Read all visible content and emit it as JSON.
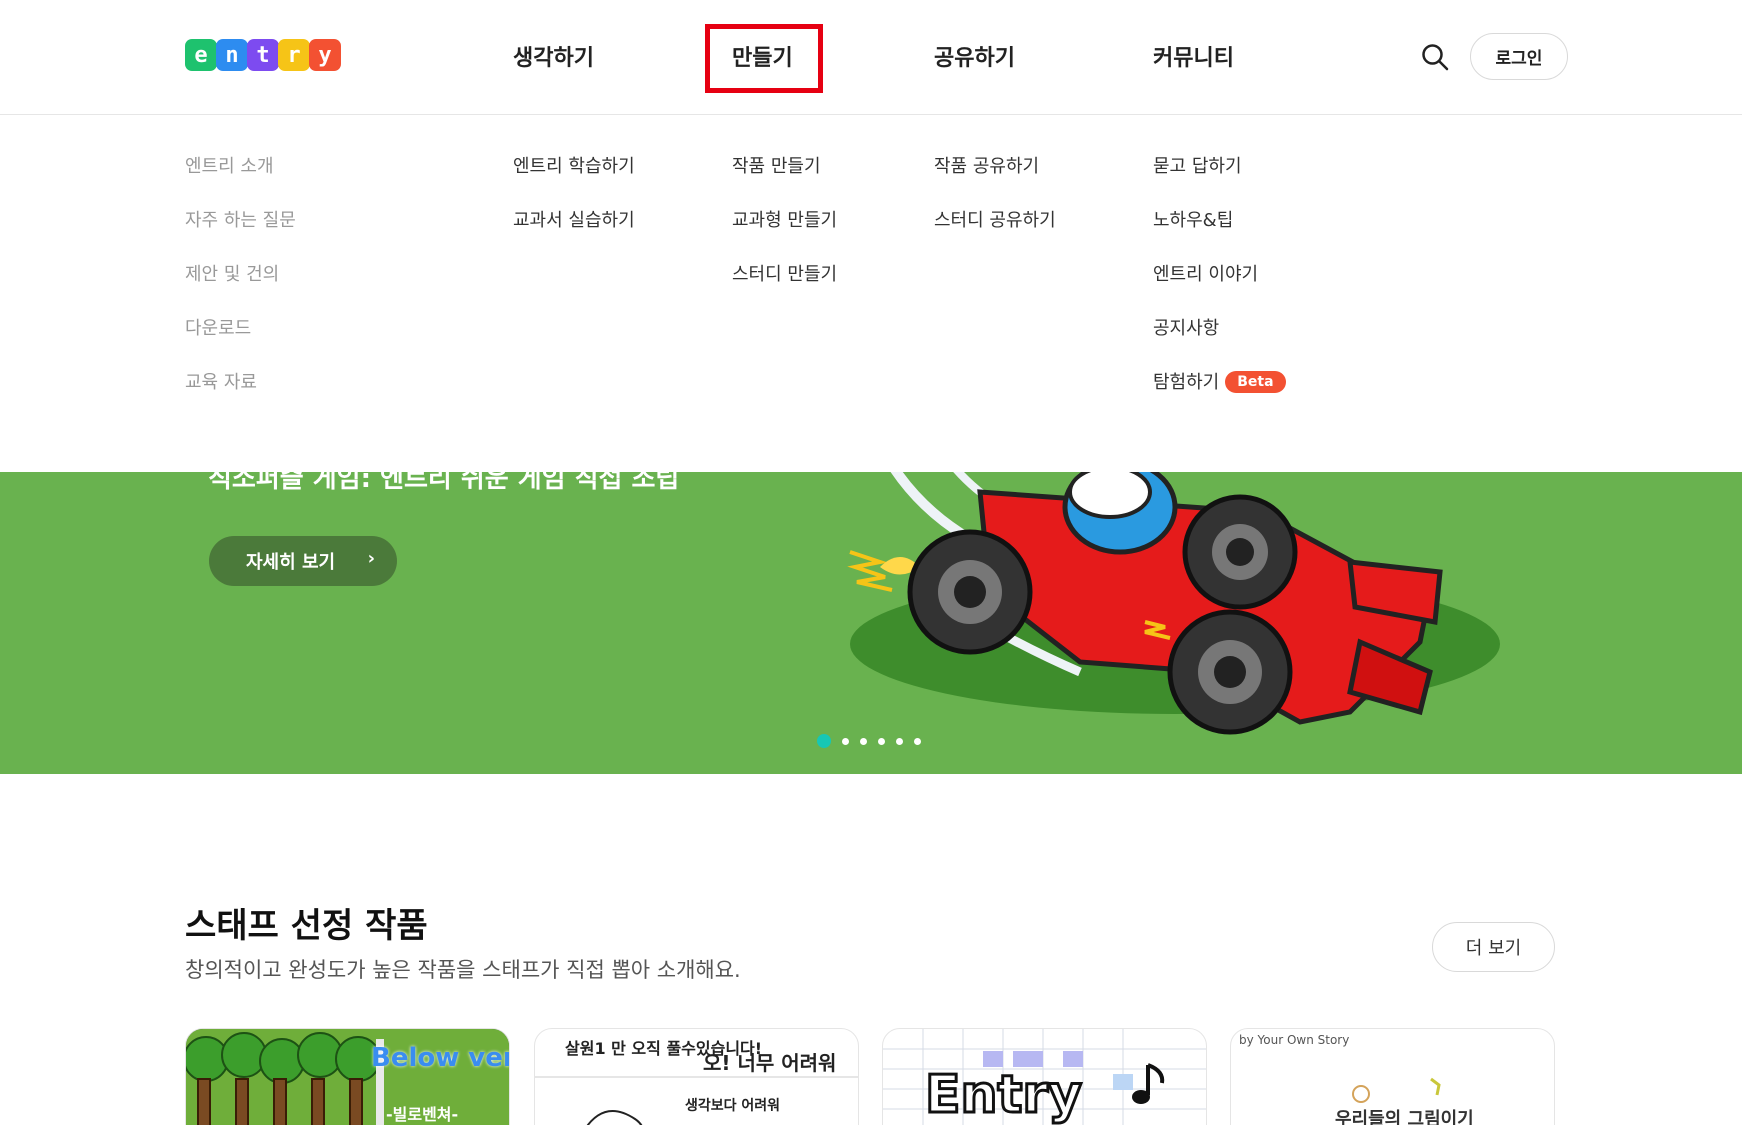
{
  "header": {
    "logo_letters": [
      "e",
      "n",
      "t",
      "r",
      "y"
    ],
    "logo_colors": [
      "#1ec26e",
      "#2d8cf0",
      "#7d4bf0",
      "#f6c417",
      "#f35132"
    ],
    "nav": [
      {
        "label": "생각하기"
      },
      {
        "label": "만들기",
        "highlighted": true
      },
      {
        "label": "공유하기"
      },
      {
        "label": "커뮤니티"
      }
    ],
    "search_icon": "search-icon",
    "login_label": "로그인"
  },
  "dropdown": {
    "about": [
      "엔트리 소개",
      "자주 하는 질문",
      "제안 및 건의",
      "다운로드",
      "교육 자료"
    ],
    "think": [
      "엔트리 학습하기",
      "교과서 실습하기"
    ],
    "create": [
      "작품 만들기",
      "교과형 만들기",
      "스터디 만들기"
    ],
    "share": [
      "작품 공유하기",
      "스터디 공유하기"
    ],
    "community": [
      "묻고 답하기",
      "노하우&팁",
      "엔트리 이야기",
      "공지사항",
      "탐험하기"
    ],
    "beta_label": "Beta"
  },
  "hero": {
    "partial_text": "직소퍼즐 게임: 엔트리 쉬운 게임 직접 조립",
    "button_label": "자세히 보기",
    "dots_total": 6,
    "active_dot": 0,
    "background_color": "#69b24f"
  },
  "staff_picks": {
    "title": "스태프 선정 작품",
    "description": "창의적이고 완성도가 높은 작품을 스태프가 직접 뽑아 소개해요.",
    "more_label": "더 보기",
    "cards": [
      {
        "title_en": "Below venture",
        "title_ko": "-빌로벤쳐-"
      },
      {
        "text1": "살원1 만 오직 풀수있습니다!",
        "text2": "오! 너무 어려워",
        "text3": "생각보다 어려워"
      },
      {
        "title": "Entry"
      },
      {
        "byline": "by Your Own Story",
        "text": "우리들의 그림이기"
      }
    ]
  }
}
